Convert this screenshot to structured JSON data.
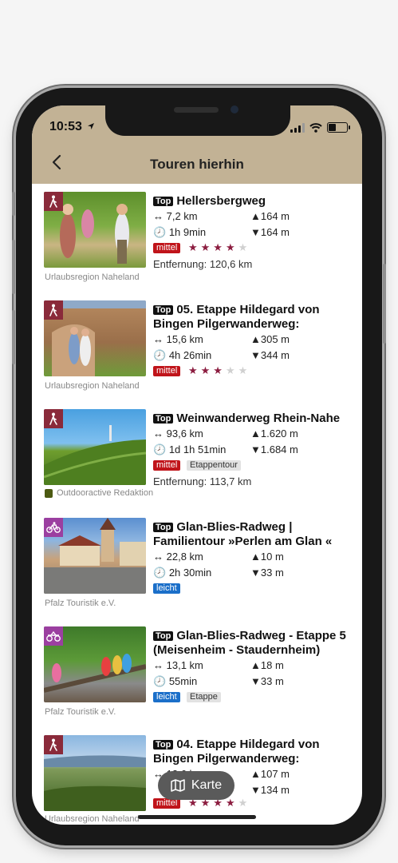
{
  "status_bar": {
    "time": "10:53"
  },
  "header": {
    "title": "Touren hierhin"
  },
  "top_tag": "Top",
  "tours": [
    {
      "name": "Hellersbergweg",
      "category": "hiking",
      "distance": "7,2 km",
      "duration": "1h 9min",
      "ascent": "164 m",
      "descent": "164 m",
      "badges": [
        {
          "text": "mittel",
          "kind": "mittel"
        }
      ],
      "rating": 4,
      "entfernung": "Entfernung: 120,6 km",
      "source": "Urlaubsregion Naheland"
    },
    {
      "name": "05. Etappe Hildegard von Bingen Pilgerwanderweg:",
      "category": "hiking",
      "distance": "15,6 km",
      "duration": "4h 26min",
      "ascent": "305 m",
      "descent": "344 m",
      "badges": [
        {
          "text": "mittel",
          "kind": "mittel"
        }
      ],
      "rating": 3,
      "entfernung": "",
      "source": "Urlaubsregion Naheland"
    },
    {
      "name": "Weinwanderweg Rhein-Nahe",
      "category": "hiking-long",
      "distance": "93,6 km",
      "duration": "1d 1h 51min",
      "ascent": "1.620 m",
      "descent": "1.684 m",
      "badges": [
        {
          "text": "mittel",
          "kind": "mittel"
        },
        {
          "text": "Etappentour",
          "kind": "gray"
        }
      ],
      "rating": 0,
      "entfernung": "Entfernung: 113,7 km",
      "source": "Outdooractive Redaktion"
    },
    {
      "name": "Glan-Blies-Radweg | Familientour »Perlen am Glan «",
      "category": "cycling",
      "distance": "22,8 km",
      "duration": "2h 30min",
      "ascent": "10 m",
      "descent": "33 m",
      "badges": [
        {
          "text": "leicht",
          "kind": "leicht"
        }
      ],
      "rating": 0,
      "entfernung": "",
      "source": "Pfalz Touristik e.V."
    },
    {
      "name": "Glan-Blies-Radweg - Etappe 5 (Meisenheim - Staudernheim)",
      "category": "draisine",
      "distance": "13,1 km",
      "duration": "55min",
      "ascent": "18 m",
      "descent": "33 m",
      "badges": [
        {
          "text": "leicht",
          "kind": "leicht"
        },
        {
          "text": "Etappe",
          "kind": "gray"
        }
      ],
      "rating": 0,
      "entfernung": "",
      "source": "Pfalz Touristik e.V."
    },
    {
      "name": "04. Etappe Hildegard von Bingen Pilgerwanderweg:",
      "category": "hiking",
      "distance": "13,6 km",
      "duration": "",
      "ascent": "107 m",
      "descent": "134 m",
      "badges": [
        {
          "text": "mittel",
          "kind": "mittel"
        }
      ],
      "rating": 4,
      "entfernung": "",
      "source": "Urlaubsregion Naheland"
    }
  ],
  "map_button": {
    "label": "Karte"
  },
  "colors": {
    "header_bg": "#c2b295",
    "hiking_cat": "#8a2a3a",
    "cycling_cat": "#9b3fa0",
    "mittel": "#c0141a",
    "leicht": "#1b6fc9",
    "star": "#8c1d40"
  }
}
